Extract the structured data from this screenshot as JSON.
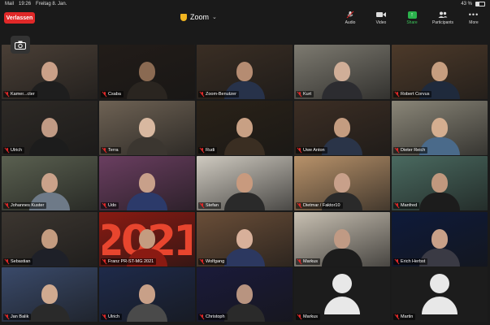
{
  "status_bar": {
    "carrier": "Mail",
    "time": "19:26",
    "date": "Freitag 8. Jan.",
    "battery": "43 %",
    "battery_level": 0.43
  },
  "meeting": {
    "leave_label": "Verlassen",
    "title": "Zoom"
  },
  "toolbar": [
    {
      "label": "Audio",
      "icon": "mic-muted-icon"
    },
    {
      "label": "Video",
      "icon": "video-icon"
    },
    {
      "label": "Share",
      "icon": "share-icon"
    },
    {
      "label": "Participants",
      "icon": "participants-icon"
    },
    {
      "label": "More",
      "icon": "more-icon"
    }
  ],
  "colors": {
    "leave": "#e02828",
    "share": "#2bb24c",
    "speaker_outline": "#7ad03c",
    "muted": "#e02828"
  },
  "participants": [
    {
      "name": "Kamer...cter",
      "bg": "#4a3f36",
      "shirt": "#1e1e1e",
      "skin": "#caa088"
    },
    {
      "name": "Csaba",
      "bg": "#221c18",
      "shirt": "#2a2520",
      "skin": "#8a6a52"
    },
    {
      "name": "Zoom-Benutzer",
      "bg": "#3a2e24",
      "shirt": "#27324a",
      "skin": "#b58c72"
    },
    {
      "name": "Kurt",
      "bg": "#7d7a70",
      "shirt": "#2c2c30",
      "skin": "#d0ae98"
    },
    {
      "name": "Robert Corvus",
      "bg": "#4d3a2a",
      "shirt": "#1f2a3c",
      "skin": "#c69e80"
    },
    {
      "name": "Ulrich",
      "bg": "#2e2a26",
      "shirt": "#1c1c1c",
      "skin": "#c09a84"
    },
    {
      "name": "Terra",
      "bg": "#6e6254",
      "shirt": "#3b3630",
      "skin": "#d8b8a0"
    },
    {
      "name": "Rudi",
      "bg": "#2a2218",
      "shirt": "#3a2e22",
      "skin": "#c8a084"
    },
    {
      "name": "Uwe Anton",
      "bg": "#3c2e24",
      "shirt": "#2a3448",
      "skin": "#c49c80"
    },
    {
      "name": "Dieter Reich",
      "bg": "#8a8678",
      "shirt": "#4a6a8a",
      "skin": "#d4ae90"
    },
    {
      "name": "Johannes Kuster",
      "bg": "#5a6050",
      "shirt": "#6e7a88",
      "skin": "#caa28a"
    },
    {
      "name": "Udo",
      "bg": "#6a3e60",
      "shirt": "#2c3a6a",
      "skin": "#c8a08a"
    },
    {
      "name": "Stefan",
      "bg": "#cfcac0",
      "shirt": "#2a2a2a",
      "skin": "#c89a7e"
    },
    {
      "name": "Dietmar / Faktor10",
      "bg": "#b8926a",
      "shirt": "#2a2a2a",
      "skin": "#c8a08a"
    },
    {
      "name": "Manfred",
      "bg": "#4a6a60",
      "shirt": "#1c1c1c",
      "skin": "#c0987e"
    },
    {
      "name": "Sebastian",
      "bg": "#3c3630",
      "shirt": "#1e2028",
      "skin": "#c49c80"
    },
    {
      "name": "Franz PR-ST-MG 2021",
      "bg": "#8a1a12",
      "shirt": "#8a1a12",
      "skin": "#c49c80"
    },
    {
      "name": "Wolfgang",
      "bg": "#6a4e38",
      "shirt": "#2c3860",
      "skin": "#d8b09a"
    },
    {
      "name": "Markus",
      "bg": "#c8c0b2",
      "shirt": "#1c1c1c",
      "skin": "#c09a84"
    },
    {
      "name": "Erich Herbst",
      "bg": "#0e1a3a",
      "shirt": "#3a3a44",
      "skin": "#c8a088"
    },
    {
      "name": "Jan Balik",
      "bg": "#3a4a6a",
      "shirt": "#2a2a2a",
      "skin": "#d0aa90"
    },
    {
      "name": "Ulrich",
      "bg": "#1e2a4a",
      "shirt": "#4a4a4a",
      "skin": "#c8a088"
    },
    {
      "name": "Christoph",
      "bg": "#1a1a3a",
      "shirt": "#2a2a2a",
      "skin": "#b89480"
    },
    {
      "name": "Markus",
      "bg": "#1c1c1c",
      "avatar": true
    },
    {
      "name": "Martin",
      "bg": "#1c1c1c",
      "avatar": true
    }
  ]
}
